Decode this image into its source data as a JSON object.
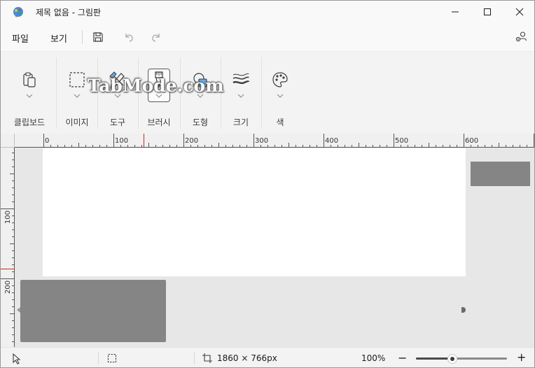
{
  "window": {
    "title": "제목 없음 - 그림판"
  },
  "menu": {
    "file": "파일",
    "view": "보기"
  },
  "ribbon": {
    "groups": [
      {
        "label": "클립보드",
        "icon": "clipboard-icon"
      },
      {
        "label": "이미지",
        "icon": "select-rectangle-icon"
      },
      {
        "label": "도구",
        "icon": "tools-icon"
      },
      {
        "label": "브러시",
        "icon": "brush-icon"
      },
      {
        "label": "도형",
        "icon": "shapes-icon"
      },
      {
        "label": "크기",
        "icon": "size-lines-icon"
      },
      {
        "label": "색",
        "icon": "palette-icon"
      }
    ],
    "watermark": "TabMode.com"
  },
  "ruler": {
    "horizontal_labels": [
      "0",
      "100",
      "200",
      "300",
      "400",
      "500",
      "600"
    ],
    "vertical_labels": [
      "100",
      "200"
    ]
  },
  "status": {
    "dimensions": "1860 × 766px",
    "zoom": "100%",
    "zoom_level": 0.4
  },
  "colors": {
    "accent": "#c42b1c",
    "placeholder_gray": "#858585"
  }
}
